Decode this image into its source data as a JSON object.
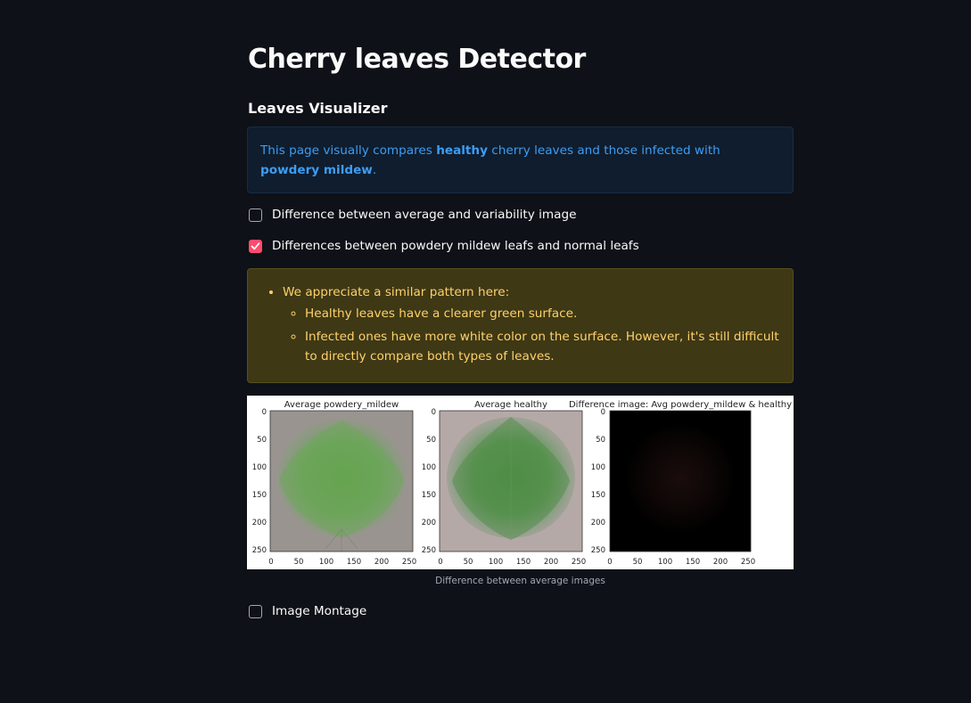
{
  "page": {
    "title": "Cherry leaves Detector",
    "subheader": "Leaves Visualizer"
  },
  "info": {
    "text_1": "This page visually compares ",
    "bold_1": "healthy",
    "text_2": " cherry leaves and those infected with ",
    "bold_2": "powdery mildew",
    "text_3": "."
  },
  "checkboxes": [
    {
      "label": "Difference between average and variability image",
      "checked": false
    },
    {
      "label": "Differences between powdery mildew leafs and normal leafs",
      "checked": true
    },
    {
      "label": "Image Montage",
      "checked": false
    }
  ],
  "warning": {
    "bullet": "We appreciate a similar pattern here:",
    "sub_1": "Healthy leaves have a clearer green surface.",
    "sub_2": "Infected ones have more white color on the surface. However, it's still difficult to directly compare both types of leaves."
  },
  "figure": {
    "titles": [
      "Average powdery_mildew",
      "Average healthy",
      "Difference image: Avg powdery_mildew & healthy"
    ],
    "ticks": [
      "0",
      "50",
      "100",
      "150",
      "200",
      "250"
    ],
    "caption": "Difference between average images"
  },
  "colors": {
    "background": "#0e1117",
    "info_text": "#3d9df3",
    "info_bg": "#0f1d2e",
    "warning_text": "#ffd16a",
    "warning_bg": "#3e3815",
    "checkbox_accent": "#ff4b6e"
  }
}
